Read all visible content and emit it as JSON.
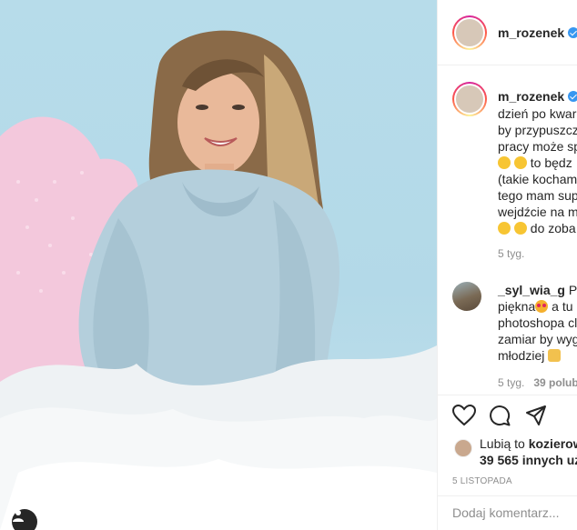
{
  "post": {
    "username": "m_rozenek",
    "verified": true
  },
  "caption": {
    "username": "m_rozenek",
    "lines": [
      "dzień po kwar",
      "by przypuszcz",
      "pracy może sp",
      "to będz",
      "(takie kocham",
      "tego mam sup",
      "wejdźcie na m",
      "do zoba"
    ],
    "time": "5 tyg."
  },
  "comment": {
    "username": "_syl_wia_g",
    "text_first": "Pan",
    "lines": [
      "piękna",
      "a tu",
      "photoshopa cl",
      "zamiar by wyg",
      "młodziej"
    ],
    "time": "5 tyg.",
    "likes": "39 polub"
  },
  "likes": {
    "prefix": "Lubią to",
    "user": "kozierow",
    "count": "39 565",
    "suffix": "innych uż"
  },
  "date": "5 LISTOPADA",
  "add_comment": {
    "placeholder": "Dodaj komentarz..."
  },
  "icons": [
    "heart-icon",
    "comment-icon",
    "share-icon",
    "user-tag-icon",
    "verified-icon"
  ],
  "colors": {
    "verified": "#3897f0",
    "photo_background": "#b7dcea",
    "secondary_text": "#8e8e8e"
  }
}
